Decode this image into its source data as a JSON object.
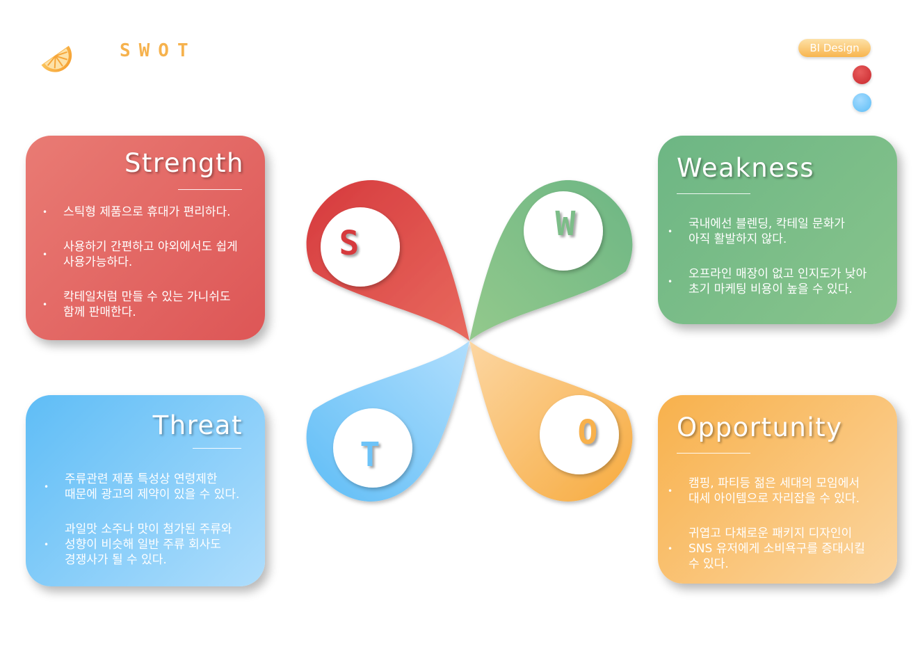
{
  "header": {
    "logo_text": "SWOT",
    "badge": "BI Design"
  },
  "colors": {
    "strength": "#dd5656",
    "weakness": "#7cbd88",
    "threat": "#6dc3f8",
    "opportunity": "#f8b14c",
    "dot_red": "#d0343a",
    "dot_blue": "#7ccbfa",
    "logo": "#f6b24d"
  },
  "diagram": {
    "petals": [
      {
        "key": "strength",
        "letter": "S"
      },
      {
        "key": "weakness",
        "letter": "W"
      },
      {
        "key": "threat",
        "letter": "T"
      },
      {
        "key": "opportunity",
        "letter": "O"
      }
    ]
  },
  "cards": {
    "strength": {
      "title": "Strength",
      "items": [
        "스틱형 제품으로 휴대가 편리하다.",
        "사용하기 간편하고 야외에서도 쉽게\n사용가능하다.",
        "칵테일처럼 만들 수 있는 가니쉬도\n함께 판매한다."
      ]
    },
    "weakness": {
      "title": "Weakness",
      "items": [
        "국내에선 블렌딩, 칵테일 문화가\n아직 활발하지 않다.",
        "오프라인 매장이 없고 인지도가 낮아\n초기 마케팅 비용이 높을 수 있다."
      ]
    },
    "threat": {
      "title": "Threat",
      "items": [
        "주류관련 제품 특성상 연령제한\n때문에 광고의 제약이 있을 수 있다.",
        "과일맛 소주나 맛이 첨가된 주류와\n성향이 비슷해 일반 주류 회사도\n경쟁사가 될 수 있다."
      ]
    },
    "opportunity": {
      "title": "Opportunity",
      "items": [
        "캠핑, 파티등 젊은 세대의 모임에서\n대세 아이템으로 자리잡을 수 있다.",
        "귀엽고 다채로운 패키지 디자인이\nSNS 유저에게 소비욕구를 증대시킬\n수 있다."
      ]
    }
  }
}
